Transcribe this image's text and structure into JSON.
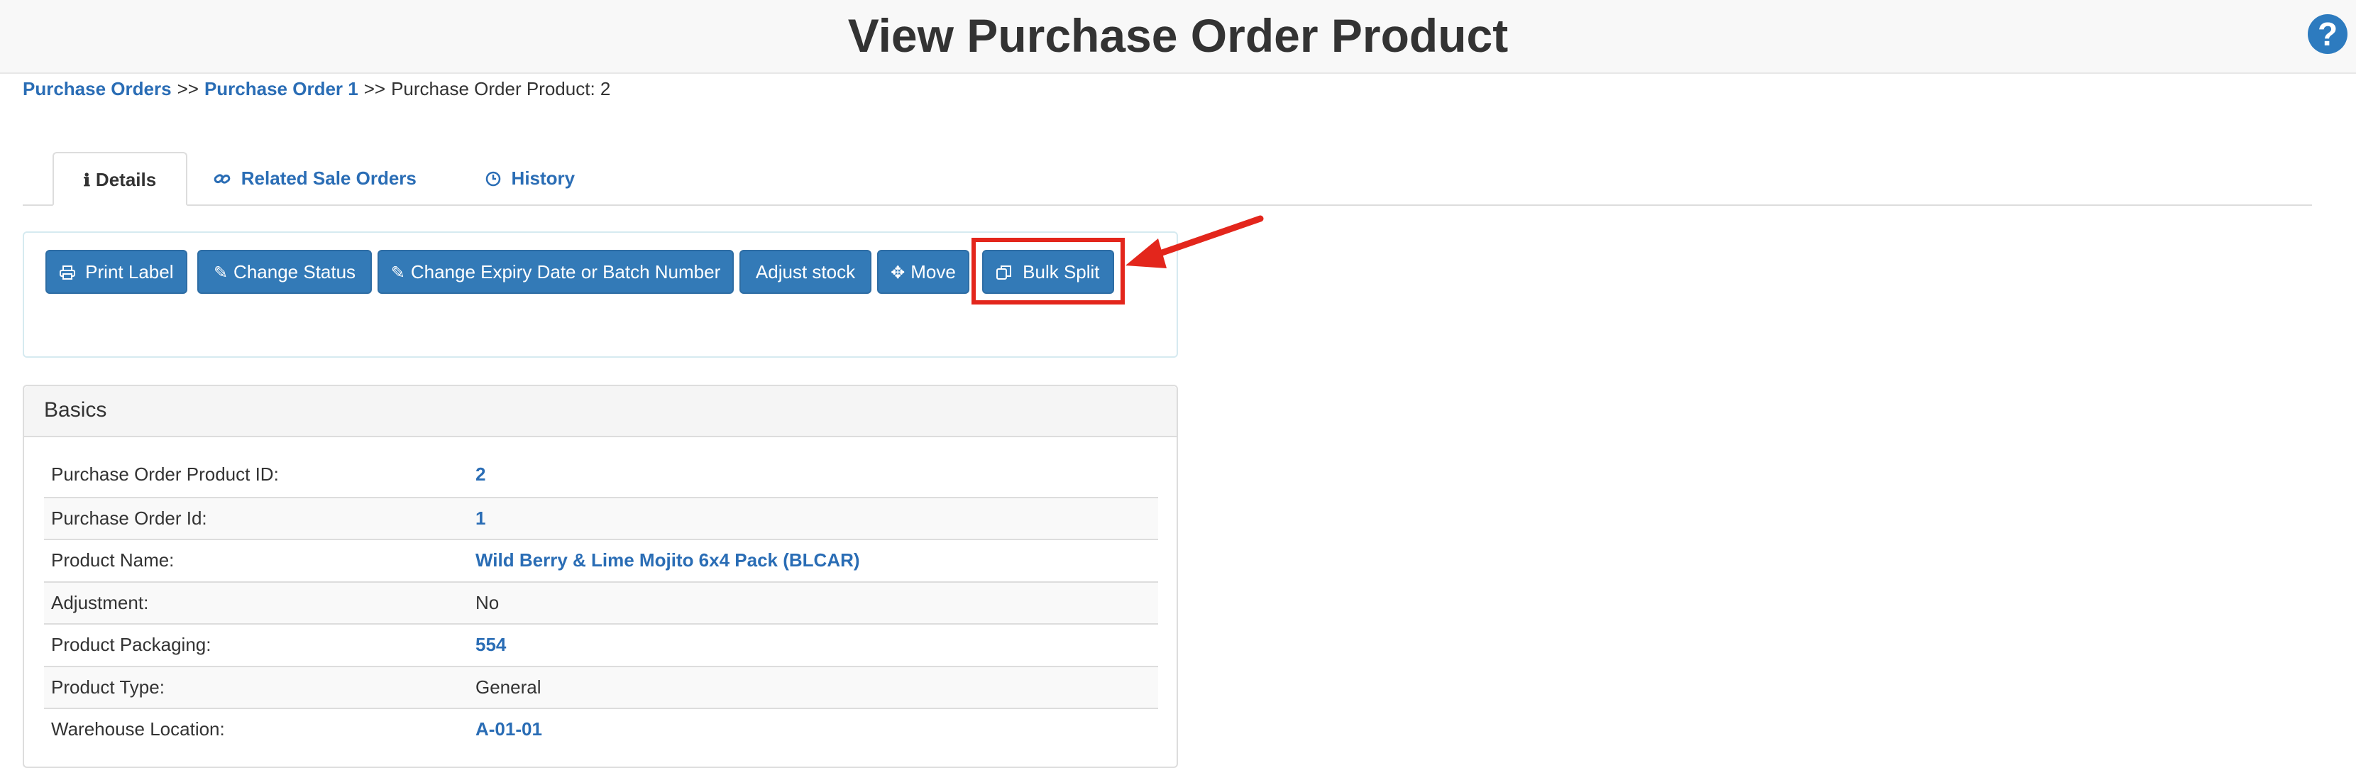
{
  "header": {
    "title": "View Purchase Order Product",
    "help_glyph": "?"
  },
  "breadcrumb": {
    "items": [
      "Purchase Orders",
      "Purchase Order 1"
    ],
    "separator": ">>",
    "current": "Purchase Order Product: 2"
  },
  "tabs": [
    {
      "label": "Details",
      "icon": "info-icon",
      "active": true
    },
    {
      "label": "Related Sale Orders",
      "icon": "link-icon",
      "active": false
    },
    {
      "label": "History",
      "icon": "clock-icon",
      "active": false
    }
  ],
  "actions": [
    {
      "label": "Print Label",
      "icon": "print-icon"
    },
    {
      "label": "Change Status",
      "icon": "pencil-icon"
    },
    {
      "label": "Change Expiry Date or Batch Number",
      "icon": "pencil-icon"
    },
    {
      "label": "Adjust stock",
      "icon": ""
    },
    {
      "label": "Move",
      "icon": "move-icon"
    },
    {
      "label": "Bulk Split",
      "icon": "copy-icon",
      "highlighted": true
    }
  ],
  "basics": {
    "title": "Basics",
    "rows": [
      {
        "label": "Purchase Order Product ID:",
        "value": "2",
        "is_link": true
      },
      {
        "label": "Purchase Order Id:",
        "value": "1",
        "is_link": true
      },
      {
        "label": "Product Name:",
        "value": "Wild Berry & Lime Mojito 6x4 Pack (BLCAR)",
        "is_link": true
      },
      {
        "label": "Adjustment:",
        "value": "No",
        "is_link": false
      },
      {
        "label": "Product Packaging:",
        "value": "554",
        "is_link": true
      },
      {
        "label": "Product Type:",
        "value": "General",
        "is_link": false
      },
      {
        "label": "Warehouse Location:",
        "value": "A-01-01",
        "is_link": true
      }
    ]
  },
  "colors": {
    "primary_button": "#337ab7",
    "link": "#2a6db5",
    "annotation": "#e3261c"
  }
}
